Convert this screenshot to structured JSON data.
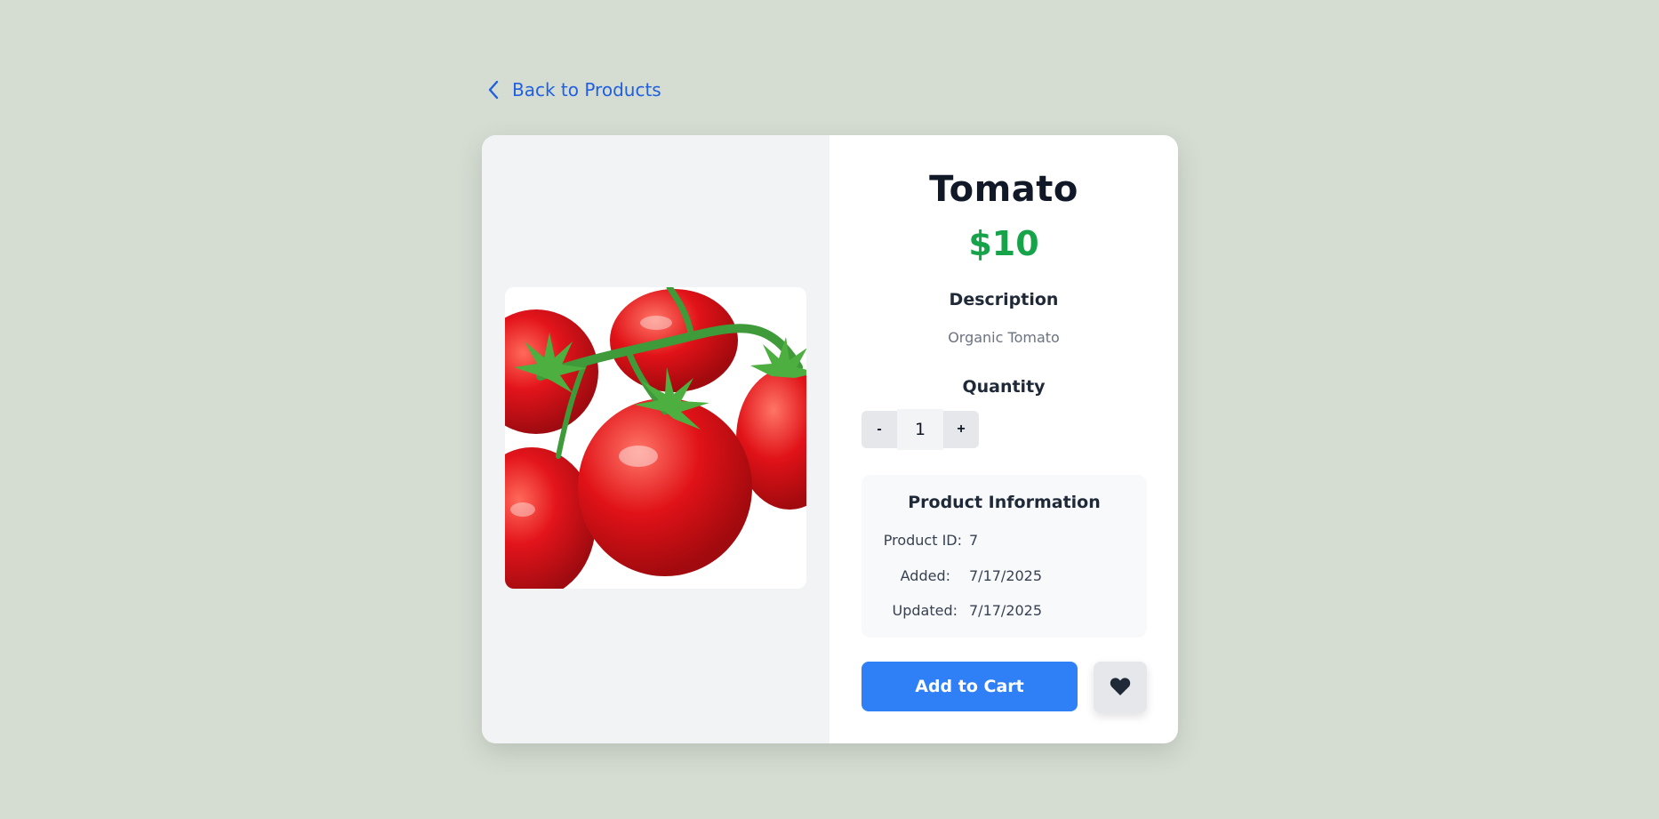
{
  "nav": {
    "back_label": "Back to Products",
    "back_icon": "chevron-left-icon"
  },
  "product": {
    "name": "Tomato",
    "price": "$10",
    "image_alt": "Tomato",
    "description_heading": "Description",
    "description": "Organic Tomato"
  },
  "quantity": {
    "heading": "Quantity",
    "minus_label": "-",
    "value": "1",
    "plus_label": "+"
  },
  "info": {
    "heading": "Product Information",
    "rows": [
      {
        "label": "Product ID:",
        "value": "7"
      },
      {
        "label": "Added:",
        "value": "7/17/2025"
      },
      {
        "label": "Updated:",
        "value": "7/17/2025"
      }
    ]
  },
  "actions": {
    "add_to_cart_label": "Add to Cart",
    "favorite_icon": "heart-icon"
  },
  "colors": {
    "page_bg": "#d5ddd3",
    "link": "#1f5fe0",
    "price": "#16a34a",
    "primary_button": "#2f80f7"
  }
}
